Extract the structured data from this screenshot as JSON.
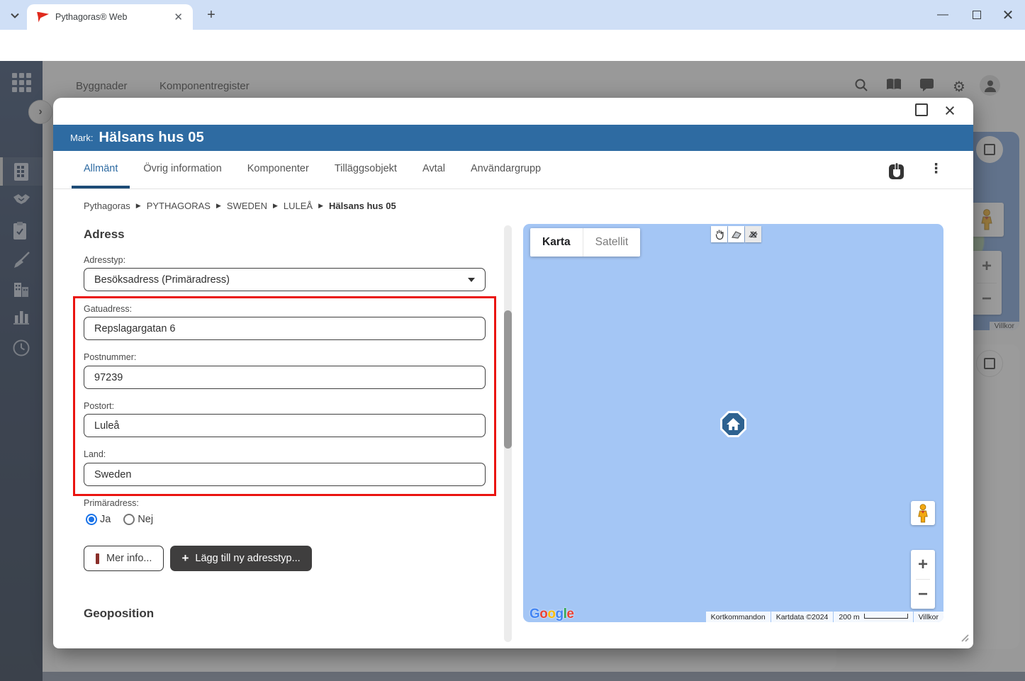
{
  "browser": {
    "tab": {
      "title": "Pythagoras® Web"
    },
    "url": "pim.pythagoras.se/py_datamanager_internaldemo/pythagorasweb/index.html?mpMM=BUILDINGS&mpSM=BUILDINGS&oCs=r80i20"
  },
  "nav": {
    "items": [
      {
        "label": "Byggnader"
      },
      {
        "label": "Komponentregister"
      }
    ]
  },
  "dialog": {
    "entity_label": "Mark:",
    "title": "Hälsans hus 05",
    "tabs": [
      {
        "label": "Allmänt",
        "active": true
      },
      {
        "label": "Övrig information",
        "active": false
      },
      {
        "label": "Komponenter",
        "active": false
      },
      {
        "label": "Tilläggsobjekt",
        "active": false
      },
      {
        "label": "Avtal",
        "active": false
      },
      {
        "label": "Användargrupp",
        "active": false
      }
    ],
    "breadcrumb": {
      "items": [
        {
          "label": "Pythagoras"
        },
        {
          "label": "PYTHAGORAS"
        },
        {
          "label": "SWEDEN"
        },
        {
          "label": "LULEÅ"
        },
        {
          "label": "Hälsans hus 05"
        }
      ]
    },
    "address": {
      "heading": "Adress",
      "type_label": "Adresstyp:",
      "type_value": "Besöksadress (Primäradress)",
      "fields": [
        {
          "label": "Gatuadress:",
          "value": "Repslagargatan 6"
        },
        {
          "label": "Postnummer:",
          "value": "97239"
        },
        {
          "label": "Postort:",
          "value": "Luleå"
        },
        {
          "label": "Land:",
          "value": "Sweden"
        }
      ],
      "primary_label": "Primäradress:",
      "primary_options": [
        {
          "label": "Ja",
          "selected": true
        },
        {
          "label": "Nej",
          "selected": false
        }
      ],
      "buttons": {
        "more_info": "Mer info...",
        "add_type": "Lägg till ny adresstyp..."
      }
    },
    "geoposition": {
      "heading": "Geoposition"
    }
  },
  "map": {
    "type_buttons": [
      {
        "label": "Karta",
        "active": true
      },
      {
        "label": "Satellit",
        "active": false
      }
    ],
    "google_letters": [
      "G",
      "o",
      "o",
      "g",
      "l",
      "e"
    ],
    "attribution": {
      "shortcuts": "Kortkommandon",
      "data": "Kartdata ©2024",
      "scale": "200 m",
      "terms": "Villkor"
    }
  },
  "background": {
    "map_terms": "Villkor"
  },
  "colors": {
    "header_blue": "#2e6ba2",
    "tab_underline": "#1d4c77",
    "annotation_red": "#ea1410",
    "map_water": "#a4c6f5",
    "sidebar_navy": "#16294a",
    "radio_blue": "#1a73e8",
    "dark_button": "#3f3e3e",
    "google_letter_colors": [
      "#4285F4",
      "#EA4335",
      "#FBBC05",
      "#4285F4",
      "#34A853",
      "#EA4335"
    ]
  }
}
